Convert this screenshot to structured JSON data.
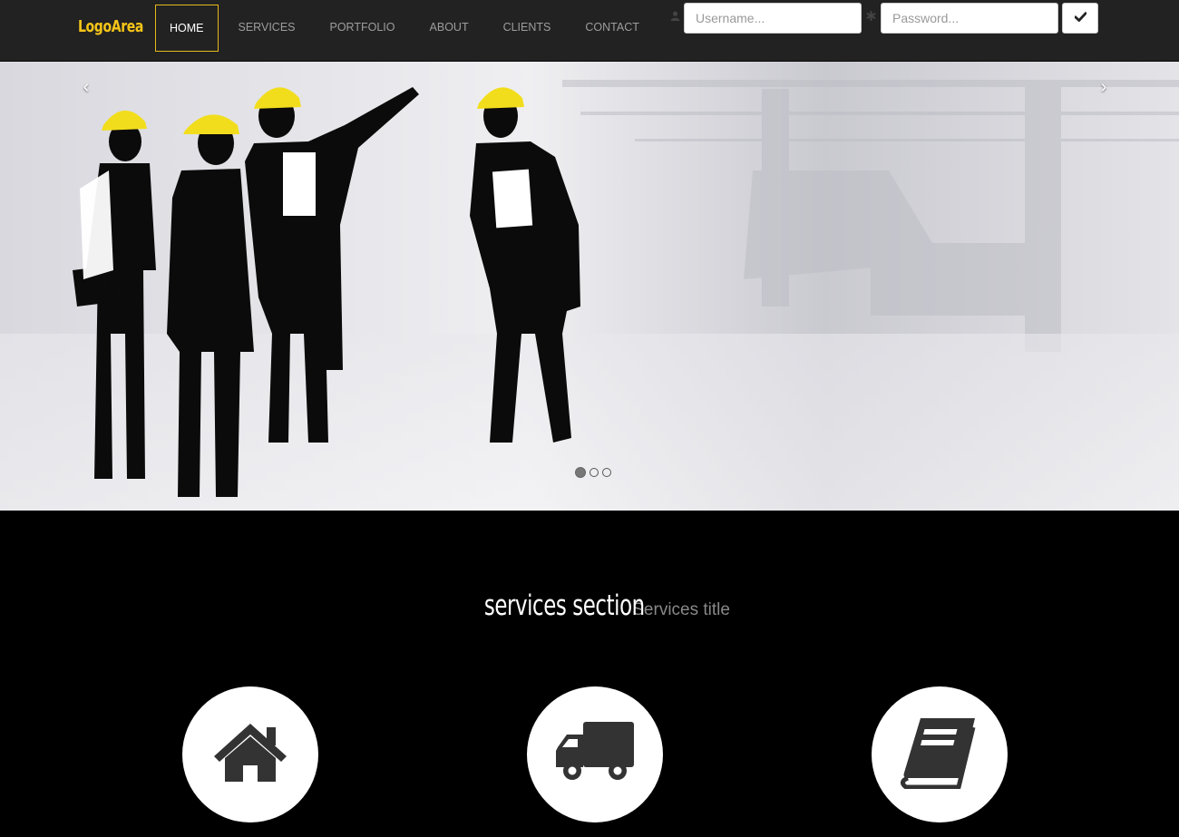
{
  "brand": {
    "name": "LogoArea",
    "color": "#f5c518"
  },
  "nav": {
    "items": [
      {
        "label": "HOME",
        "active": true
      },
      {
        "label": "SERVICES",
        "active": false
      },
      {
        "label": "PORTFOLIO",
        "active": false
      },
      {
        "label": "ABOUT",
        "active": false
      },
      {
        "label": "CLIENTS",
        "active": false
      },
      {
        "label": "CONTACT",
        "active": false
      }
    ]
  },
  "login": {
    "username_placeholder": "Username...",
    "password_placeholder": "Password...",
    "username_icon": "user-icon",
    "password_icon": "asterisk-icon",
    "submit_icon": "check-icon"
  },
  "carousel": {
    "prev_icon": "chevron-left-icon",
    "next_icon": "chevron-right-icon",
    "prev_glyph": "‹",
    "next_glyph": "›",
    "slides": 3,
    "active_slide": 1
  },
  "services": {
    "title": "services section",
    "subtitle": "Services title",
    "items": [
      {
        "icon": "home-icon"
      },
      {
        "icon": "truck-icon"
      },
      {
        "icon": "book-icon"
      }
    ]
  },
  "colors": {
    "accent": "#e5b81c",
    "navbar": "#222222",
    "background": "#000000"
  }
}
